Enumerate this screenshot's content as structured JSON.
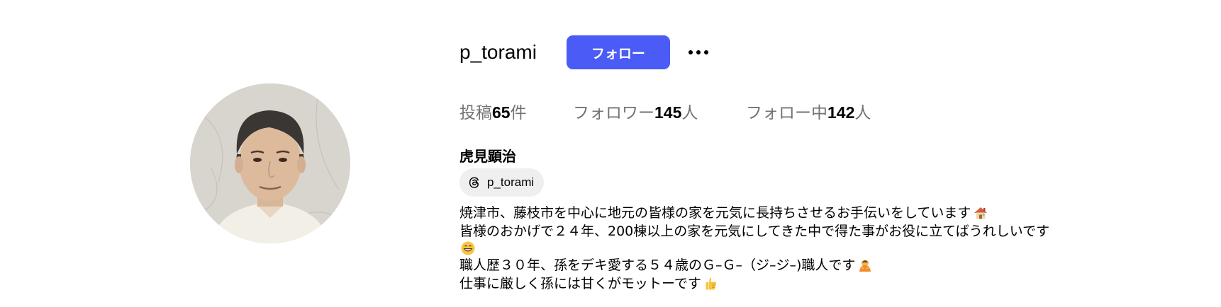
{
  "profile": {
    "username": "p_torami",
    "follow_label": "フォロー",
    "more_icon": "more-horizontal-icon",
    "display_name": "虎見顕治",
    "threads": {
      "icon": "threads-icon",
      "handle": "p_torami"
    }
  },
  "stats": {
    "posts": {
      "prefix": "投稿",
      "count": "65",
      "suffix": "件"
    },
    "followers": {
      "prefix": "フォロワー",
      "count": "145",
      "suffix": "人"
    },
    "following": {
      "prefix": "フォロー中",
      "count": "142",
      "suffix": "人"
    }
  },
  "bio": {
    "line1": "焼津市、藤枝市を中心に地元の皆様の家を元気に長持ちさせるお手伝いをしています",
    "line1_emoji": "house-icon",
    "line2": "皆様のおかげで２４年、200棟以上の家を元気にしてきた中で得た事がお役に立てばうれしいです",
    "line3_emoji": "grinning-face-icon",
    "line4": "職人歴３０年、孫をデキ愛する５４歳のＧ–Ｇ–（ジ–ジ–)職人です",
    "line4_emoji": "person-bowing-icon",
    "line5": "仕事に厳しく孫には甘くがモットーです",
    "line5_emoji": "thumbs-up-icon"
  },
  "colors": {
    "follow_button": "#4a5cf5",
    "muted_text": "#737373",
    "badge_bg": "#efefef"
  }
}
